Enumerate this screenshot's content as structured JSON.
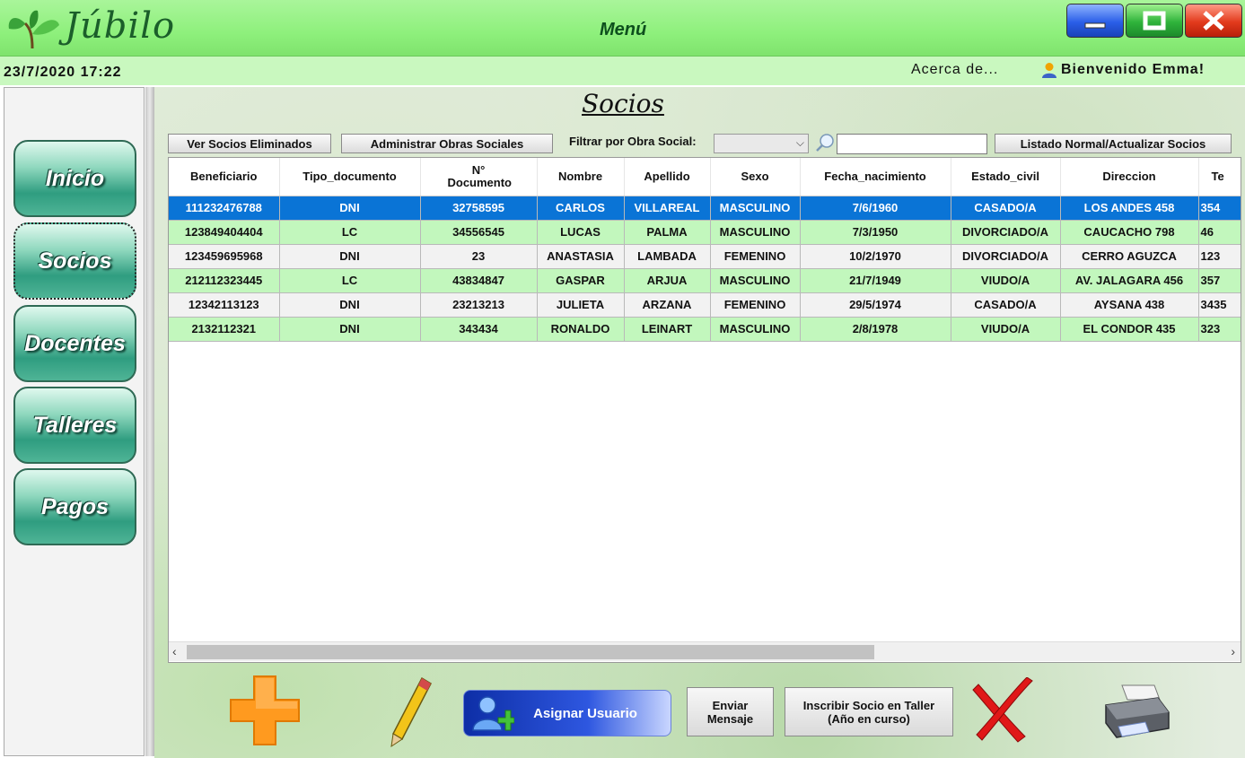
{
  "app": {
    "title": "Júbilo",
    "window_title": "Menú"
  },
  "status": {
    "datetime": "23/7/2020 17:22",
    "about": "Acerca de...",
    "welcome": "Bienvenido Emma!"
  },
  "sidebar": {
    "items": [
      {
        "label": "Inicio"
      },
      {
        "label": "Socios",
        "active": true
      },
      {
        "label": "Docentes"
      },
      {
        "label": "Talleres"
      },
      {
        "label": "Pagos"
      }
    ]
  },
  "page": {
    "title": "Socios"
  },
  "toolbar": {
    "deleted_label": "Ver Socios Eliminados",
    "insurance_label": "Administrar Obras Sociales",
    "filter_label": "Filtrar por Obra Social:",
    "filter_value": "",
    "search_value": "",
    "refresh_label": "Listado Normal/Actualizar Socios"
  },
  "table": {
    "columns": [
      "Beneficiario",
      "Tipo_documento",
      "N° Documento",
      "Nombre",
      "Apellido",
      "Sexo",
      "Fecha_nacimiento",
      "Estado_civil",
      "Direccion",
      "Te"
    ],
    "rows": [
      [
        "111232476788",
        "DNI",
        "32758595",
        "CARLOS",
        "VILLAREAL",
        "MASCULINO",
        "7/6/1960",
        "CASADO/A",
        "LOS ANDES 458",
        "354"
      ],
      [
        "123849404404",
        "LC",
        "34556545",
        "LUCAS",
        "PALMA",
        "MASCULINO",
        "7/3/1950",
        "DIVORCIADO/A",
        "CAUCACHO 798",
        "46"
      ],
      [
        "123459695968",
        "DNI",
        "23",
        "ANASTASIA",
        "LAMBADA",
        "FEMENINO",
        "10/2/1970",
        "DIVORCIADO/A",
        "CERRO AGUZCA",
        "123"
      ],
      [
        "212112323445",
        "LC",
        "43834847",
        "GASPAR",
        "ARJUA",
        "MASCULINO",
        "21/7/1949",
        "VIUDO/A",
        "AV. JALAGARA 456",
        "357"
      ],
      [
        "12342113123",
        "DNI",
        "23213213",
        "JULIETA",
        "ARZANA",
        "FEMENINO",
        "29/5/1974",
        "CASADO/A",
        "AYSANA 438",
        "3435"
      ],
      [
        "2132112321",
        "DNI",
        "343434",
        "RONALDO",
        "LEINART",
        "MASCULINO",
        "2/8/1978",
        "VIUDO/A",
        "EL CONDOR 435",
        "323"
      ]
    ],
    "selected_row": 0
  },
  "actions": {
    "assign_user": "Asignar Usuario",
    "send_message_1": "Enviar",
    "send_message_2": "Mensaje",
    "enroll_1": "Inscribir Socio en Taller",
    "enroll_2": "(Año en curso)"
  },
  "icons": [
    "plant-logo-icon",
    "minimize-icon",
    "maximize-icon",
    "close-icon",
    "user-icon",
    "search-icon",
    "add-icon",
    "edit-pencil-icon",
    "add-user-icon",
    "delete-x-icon",
    "printer-icon"
  ],
  "colors": {
    "titlebar": "#8ef07c",
    "statusbar": "#c9f8bf",
    "row_green": "#c2f7bd",
    "row_selected": "#0a74d6",
    "nav_button": "#2f9d80"
  }
}
